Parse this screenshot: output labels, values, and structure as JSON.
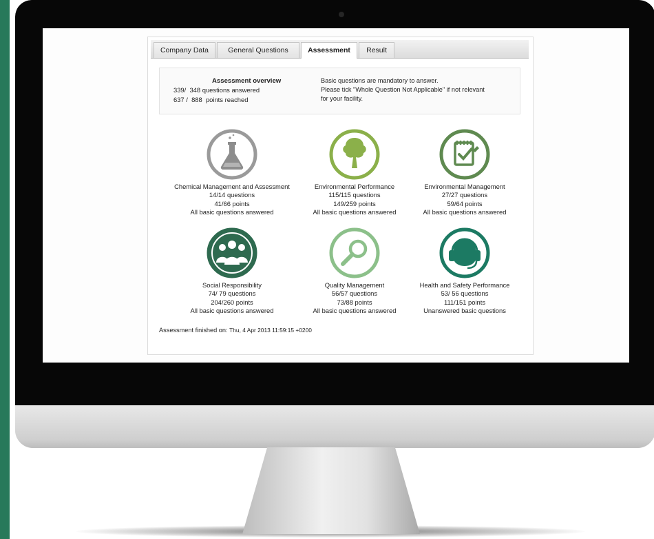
{
  "tabs": [
    {
      "label": "Company Data",
      "active": false
    },
    {
      "label": "General Questions",
      "active": false
    },
    {
      "label": "Assessment",
      "active": true
    },
    {
      "label": "Result",
      "active": false
    }
  ],
  "overview": {
    "title": "Assessment overview",
    "questions_answered": "339/",
    "questions_total": "348",
    "questions_label": "questions answered",
    "points_reached": "637 /",
    "points_total": "888",
    "points_label": "points reached",
    "note_line1": "Basic questions are mandatory to answer.",
    "note_line2": "Please tick \"Whole Question Not Applicable\" if not relevant",
    "note_line3": "for your facility."
  },
  "categories": [
    {
      "name": "Chemical Management and Assessment",
      "questions": "14/14 questions",
      "points": "41/66   points",
      "status": "All basic questions answered",
      "icon": "flask-icon",
      "color": "#9a9a9a"
    },
    {
      "name": "Environmental Performance",
      "questions": "115/115 questions",
      "points": "149/259   points",
      "status": "All basic questions answered",
      "icon": "tree-icon",
      "color": "#8bb04a"
    },
    {
      "name": "Environmental Management",
      "questions": "27/27 questions",
      "points": "59/64   points",
      "status": "All basic questions answered",
      "icon": "checklist-icon",
      "color": "#5f8a50"
    },
    {
      "name": "Social Responsibility",
      "questions": "74/  79 questions",
      "points": "204/260   points",
      "status": "All basic questions answered",
      "icon": "people-icon",
      "color": "#2e6a4f"
    },
    {
      "name": "Quality Management",
      "questions": "56/57 questions",
      "points": "73/88   points",
      "status": "All basic questions answered",
      "icon": "magnifier-icon",
      "color": "#8cc08a"
    },
    {
      "name": "Health and Safety Performance",
      "questions": "53/  56 questions",
      "points": "111/151   points",
      "status": "Unanswered basic questions",
      "icon": "headset-icon",
      "color": "#1c7a63"
    }
  ],
  "footer": {
    "label": "Assessment finished on:",
    "date": "Thu, 4 Apr 2013 11:59:15 +0200"
  }
}
